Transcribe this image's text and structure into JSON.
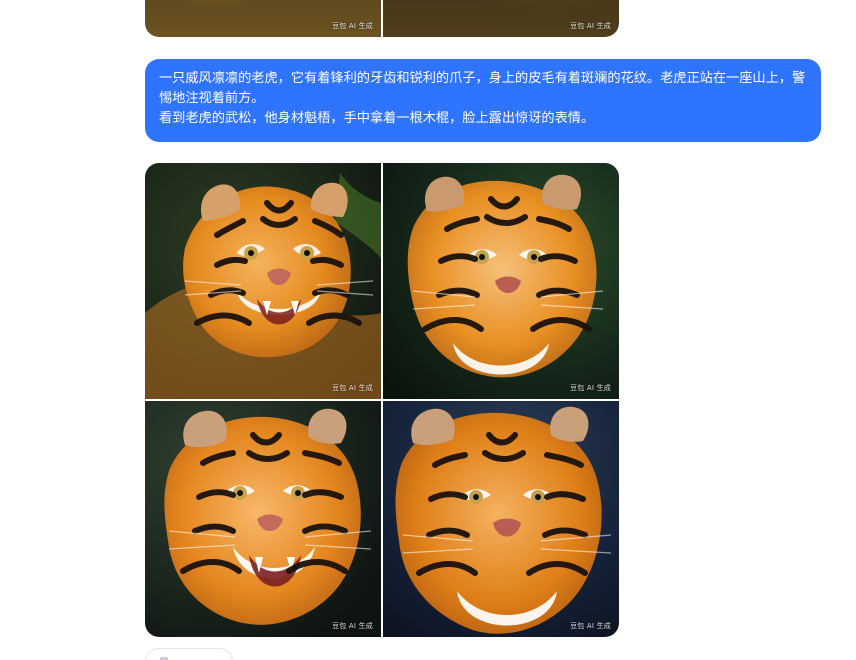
{
  "conversation": {
    "previous_images": {
      "watermark": "豆包 AI 生成",
      "tiles": [
        {
          "alt": "previous-result-1"
        },
        {
          "alt": "previous-result-2"
        }
      ]
    },
    "user_message": {
      "lines": [
        "一只威风凛凛的老虎，它有着锋利的牙齿和锐利的爪子，身上的皮毛有着斑斓的花纹。老虎正站在一座山上，警惕地注视着前方。",
        "看到老虎的武松，他身材魁梧，手中拿着一根木棍，脸上露出惊讶的表情。"
      ]
    },
    "result_images": {
      "watermark": "豆包 AI 生成",
      "tiles": [
        {
          "alt": "tiger-result-1"
        },
        {
          "alt": "tiger-result-2"
        },
        {
          "alt": "tiger-result-3"
        },
        {
          "alt": "tiger-result-4"
        }
      ]
    }
  },
  "colors": {
    "user_bubble_bg": "#2f74ff",
    "page_bg": "#ffffff",
    "tiger_orange": "#e58a1f",
    "tiger_stripe": "#1b120c"
  }
}
